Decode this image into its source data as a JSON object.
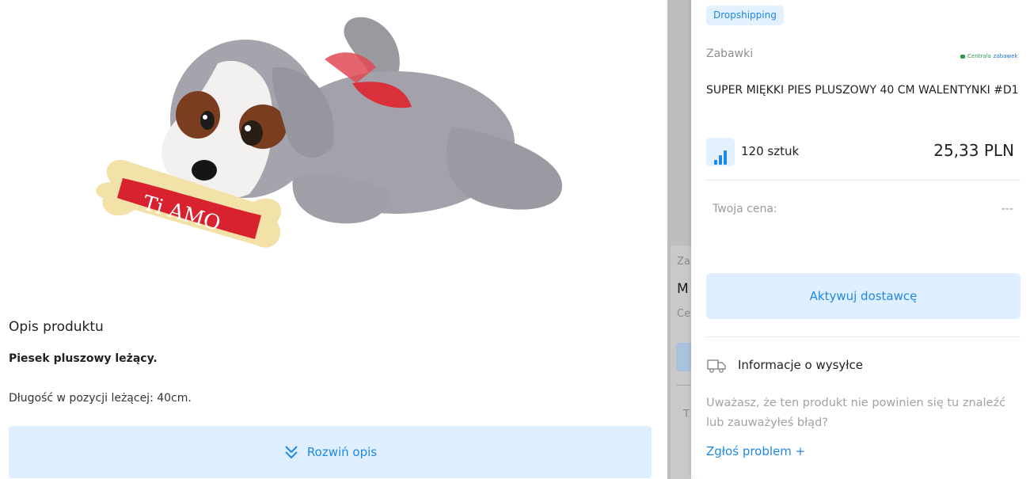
{
  "product": {
    "image_alt": "Pluszowy pies z kością Ti AMO",
    "bone_text": "Ti AMO"
  },
  "description": {
    "title": "Opis produktu",
    "bold_line": "Piesek pluszowy leżący.",
    "text_line": "Długość w pozycji leżącej: 40cm.",
    "expand_label": "Rozwiń opis"
  },
  "background_card": {
    "category_fragment": "Za",
    "name_fragment": "M",
    "supplier_fragment": "Ce",
    "label_fragment": "T"
  },
  "panel": {
    "badge": "Dropshipping",
    "category": "Zabawki",
    "supplier_logo": {
      "part1": "Centrala",
      "part2": "zabawek"
    },
    "product_name": "SUPER MIĘKKI PIES PLUSZOWY 40 CM WALENTYNKI #D1",
    "stock": "120 sztuk",
    "price": "25,33 PLN",
    "your_price_label": "Twoja cena:",
    "your_price_value": "---",
    "activate_label": "Aktywuj dostawcę",
    "shipping_label": "Informacje o wysyłce",
    "problem_text": "Uważasz, że ten produkt nie powinien się tu znaleźć lub zauważyłeś błąd?",
    "report_label": "Zgłoś problem +"
  },
  "colors": {
    "accent": "#1e88e5",
    "accent_bg": "#e0efff",
    "muted": "#9a9a9a"
  }
}
